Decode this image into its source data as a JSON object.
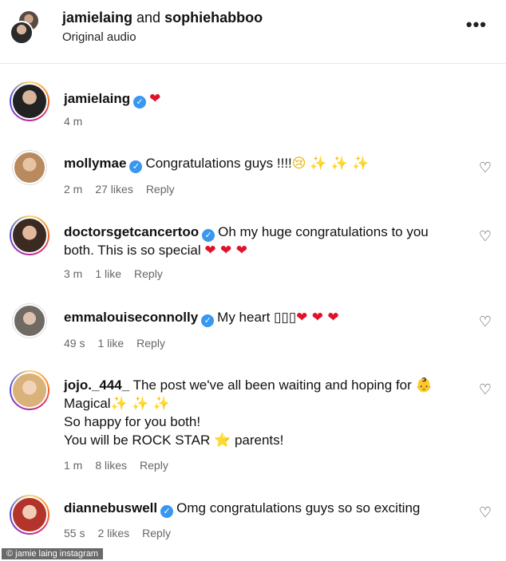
{
  "header": {
    "user1": "jamielaing",
    "and": " and ",
    "user2": "sophiehabboo",
    "subtitle": "Original audio",
    "more": "•••"
  },
  "caption": {
    "username": "jamielaing",
    "text": "❤",
    "time": "4 m"
  },
  "comments": [
    {
      "username": "mollymae",
      "line1": "Congratulations guys !!!!",
      "emoji1": "😢",
      "emoji2": "✨ ✨ ✨",
      "time": "2 m",
      "likes": "27 likes",
      "reply": "Reply"
    },
    {
      "username": "doctorsgetcancertoo",
      "line1": "Oh my huge congratulations to you",
      "line2": "both. This is so special",
      "hearts": "❤ ❤ ❤",
      "time": "3 m",
      "likes": "1 like",
      "reply": "Reply"
    },
    {
      "username": "emmalouiseconnolly",
      "line1": "My heart",
      "boxes": "▯▯▯",
      "hearts": "❤ ❤ ❤",
      "time": "49 s",
      "likes": "1 like",
      "reply": "Reply"
    },
    {
      "username": "jojo._444_",
      "line1": "The post we've all been waiting and hoping for",
      "baby": "👶",
      "line2": "Magical",
      "sparkles": "✨ ✨ ✨",
      "line3": "So happy for you both!",
      "line4a": "You will be ROCK STAR",
      "star": "⭐",
      "line4b": "parents!",
      "time": "1 m",
      "likes": "8 likes",
      "reply": "Reply"
    },
    {
      "username": "diannebuswell",
      "line1": "Omg congratulations guys so so exciting",
      "time": "55 s",
      "likes": "2 likes",
      "reply": "Reply"
    }
  ],
  "like_icon": "♡",
  "verified_icon": "✓",
  "watermark": "© jamie laing instagram"
}
